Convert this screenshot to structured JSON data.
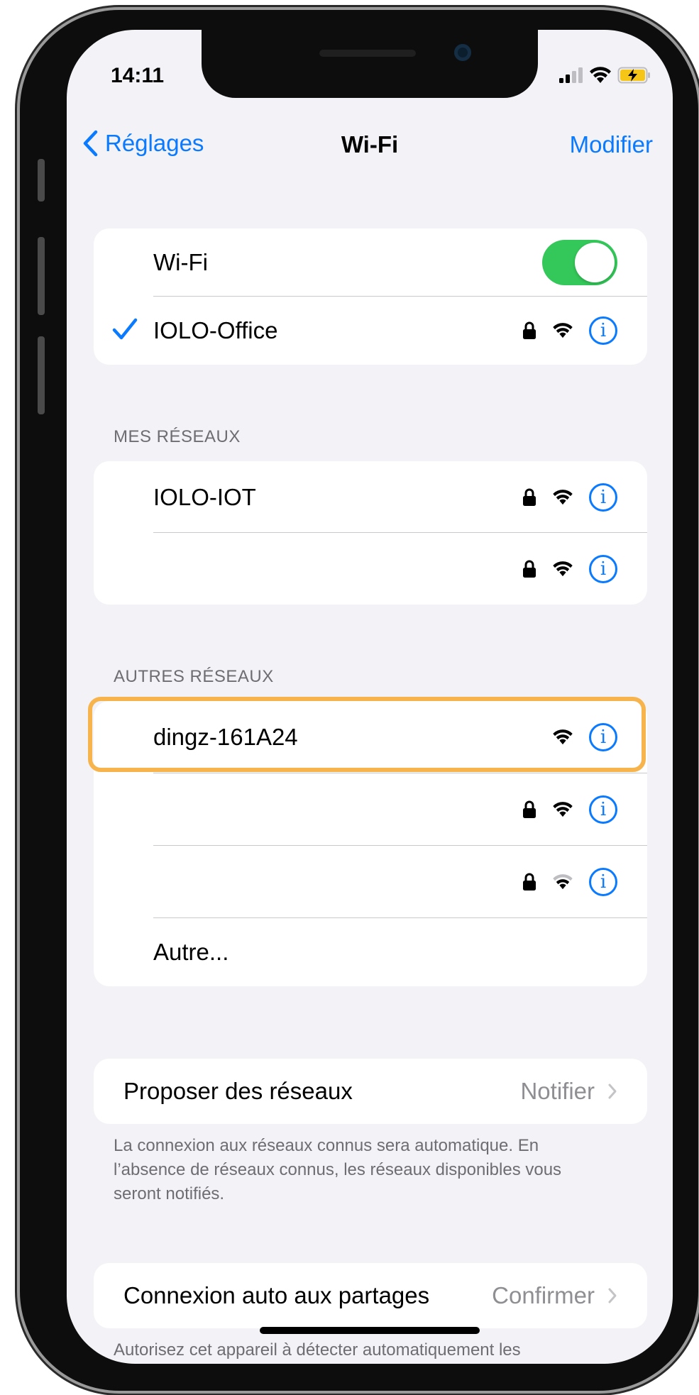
{
  "status_bar": {
    "time": "14:11"
  },
  "nav": {
    "back_label": "Réglages",
    "title": "Wi-Fi",
    "edit_label": "Modifier"
  },
  "wifi_toggle": {
    "label": "Wi-Fi",
    "on": true
  },
  "connected": {
    "name": "IOLO-Office",
    "locked": true
  },
  "my_networks": {
    "header": "MES RÉSEAUX",
    "items": [
      {
        "name": "IOLO-IOT",
        "locked": true
      },
      {
        "name": "",
        "locked": true
      }
    ]
  },
  "other_networks": {
    "header": "AUTRES RÉSEAUX",
    "items": [
      {
        "name": "dingz-161A24",
        "locked": false,
        "highlighted": true
      },
      {
        "name": "",
        "locked": true
      },
      {
        "name": "",
        "locked": true,
        "weak_signal": true
      }
    ],
    "other_label": "Autre..."
  },
  "ask_to_join": {
    "label": "Proposer des réseaux",
    "value": "Notifier",
    "note": "La connexion aux réseaux connus sera automatique. En l’absence de réseaux connus, les réseaux disponibles vous seront notifiés."
  },
  "auto_hotspot": {
    "label": "Connexion auto aux partages",
    "value": "Confirmer",
    "note": "Autorisez cet appareil à détecter automatiquement les"
  },
  "colors": {
    "accent": "#0a7aff",
    "toggle_on": "#34c759",
    "highlight": "#f7b44d",
    "background": "#f2f2f7"
  }
}
